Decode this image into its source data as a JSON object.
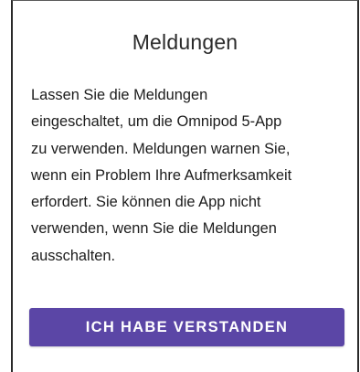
{
  "dialog": {
    "title": "Meldungen",
    "body_lines": [
      "Lassen Sie die Meldungen",
      "eingeschaltet, um die Omnipod 5-App",
      "zu verwenden. Meldungen warnen Sie,",
      "wenn ein Problem Ihre Aufmerksamkeit",
      "erfordert. Sie können die App nicht",
      "verwenden, wenn Sie die Meldungen",
      "ausschalten."
    ],
    "confirm_label": "ICH HABE VERSTANDEN"
  },
  "colors": {
    "accent": "#5b46a6",
    "background": "#ffffff",
    "text": "#1c1c1c"
  }
}
